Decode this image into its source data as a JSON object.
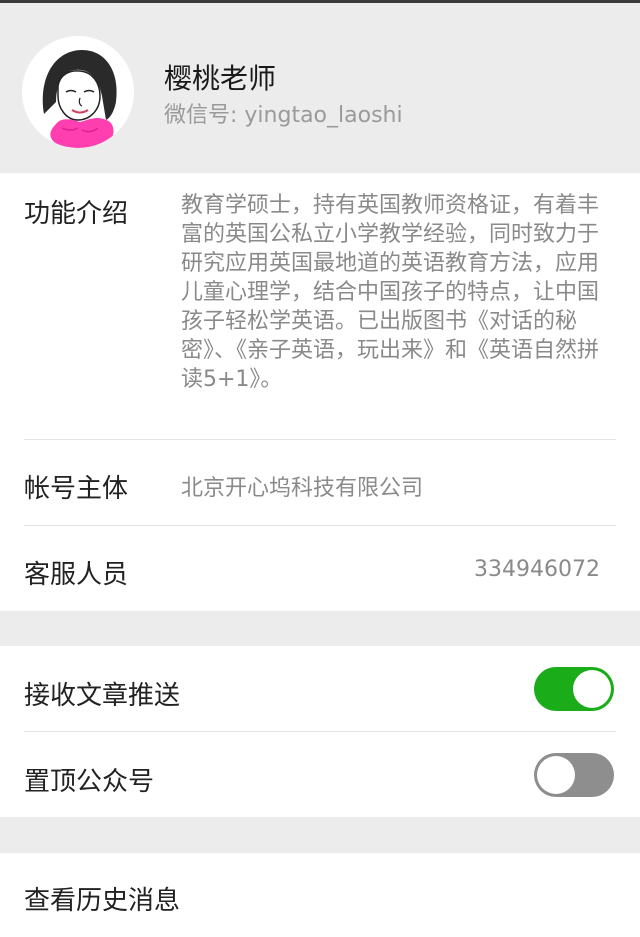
{
  "profile": {
    "name": "樱桃老师",
    "wechat_id": "微信号: yingtao_laoshi"
  },
  "intro": {
    "label": "功能介绍",
    "text": "教育学硕士，持有英国教师资格证，有着丰富的英国公私立小学教学经验，同时致力于研究应用英国最地道的英语教育方法，应用儿童心理学，结合中国孩子的特点，让中国孩子轻松学英语。已出版图书《对话的秘密》、《亲子英语，玩出来》和《英语自然拼读5+1》。"
  },
  "account_subject": {
    "label": "帐号主体",
    "value": "北京开心坞科技有限公司"
  },
  "customer_service": {
    "label": "客服人员",
    "value": "334946072"
  },
  "settings": {
    "receive_push": {
      "label": "接收文章推送",
      "enabled": true
    },
    "pin_top": {
      "label": "置顶公众号",
      "enabled": false
    }
  },
  "history": {
    "label": "查看历史消息"
  },
  "colors": {
    "accent_green": "#1aad19",
    "toggle_off": "#8e8e8e",
    "background": "#ececec"
  }
}
